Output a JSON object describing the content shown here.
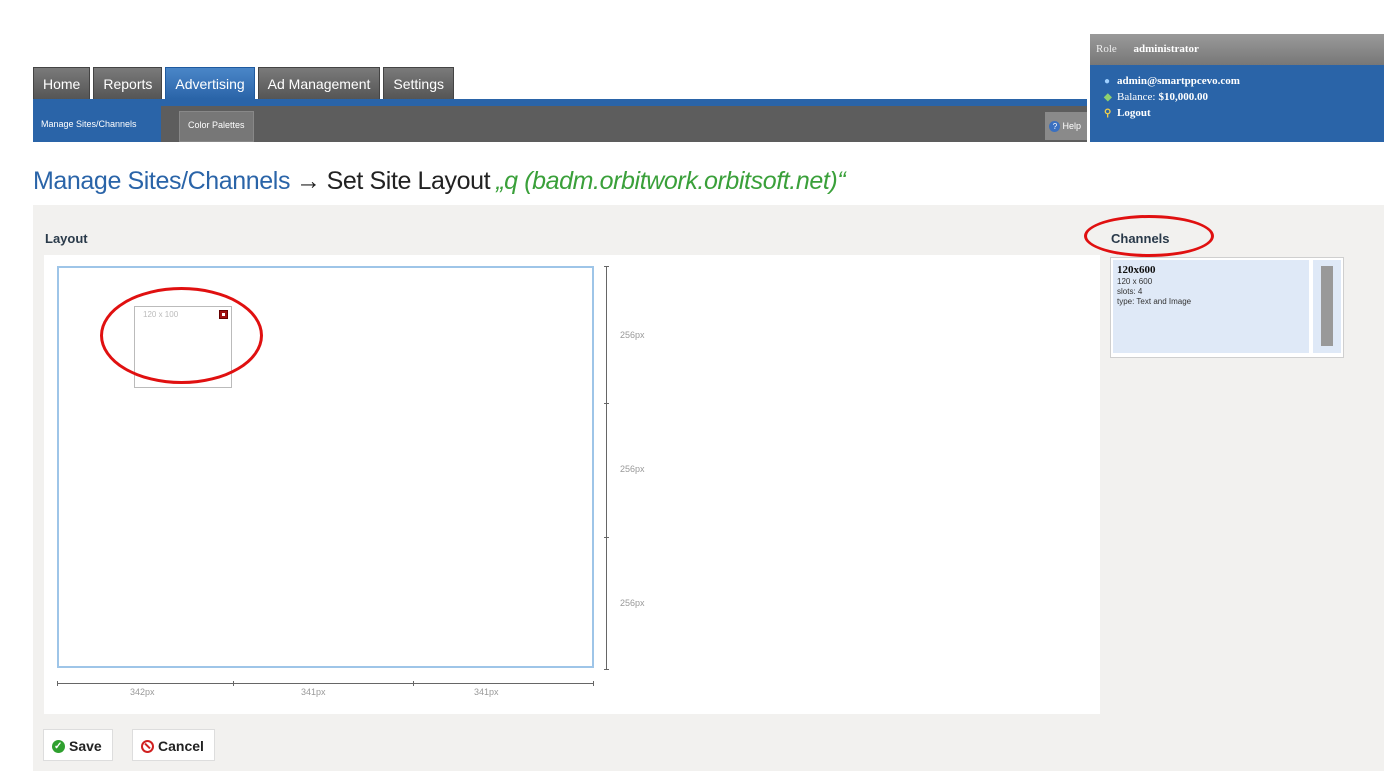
{
  "nav": {
    "main_tabs": [
      "Home",
      "Reports",
      "Advertising",
      "Ad Management",
      "Settings"
    ],
    "active_tab": "Advertising",
    "sub_tabs": [
      "Manage Sites/Channels",
      "Color Palettes"
    ],
    "help_label": "Help"
  },
  "user": {
    "role_label": "Role",
    "role_value": "administrator",
    "email": "admin@smartppcevo.com",
    "balance_label": "Balance:",
    "balance_value": "$10,000.00",
    "logout_label": "Logout",
    "icons": [
      "user-icon",
      "money-icon",
      "key-icon"
    ]
  },
  "heading": {
    "crumb": "Manage Sites/Channels",
    "arrow": "→",
    "title": "Set Site Layout",
    "site": "„q (badm.orbitwork.orbitsoft.net)“"
  },
  "layout": {
    "label": "Layout",
    "slot_size": "120 x 100",
    "v_rulers": [
      "256px",
      "256px",
      "256px"
    ],
    "h_rulers": [
      "342px",
      "341px",
      "341px"
    ]
  },
  "channels": {
    "label": "Channels",
    "items": [
      {
        "name": "120x600",
        "size": "120 x 600",
        "slots": "slots: 4",
        "type": "type: Text and Image"
      }
    ]
  },
  "buttons": {
    "save": "Save",
    "cancel": "Cancel"
  },
  "colors": {
    "brand_blue": "#2a64a8",
    "site_green": "#3aa03a",
    "annotation_red": "#e01010"
  }
}
